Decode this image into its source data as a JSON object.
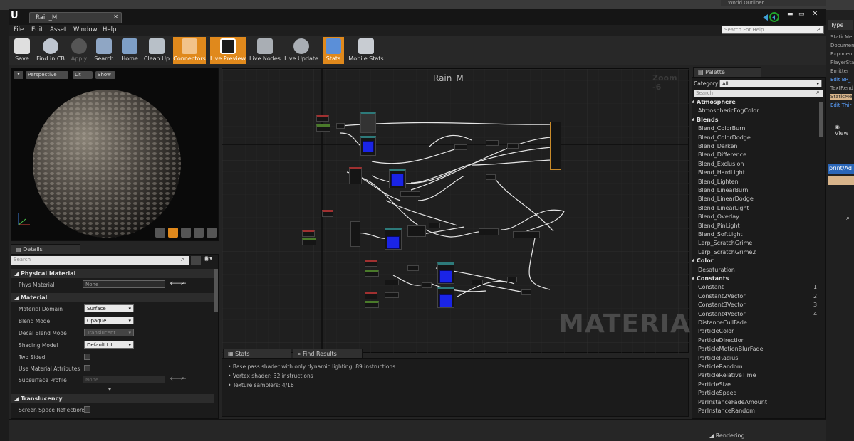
{
  "window": {
    "title": "Rain_M",
    "help_placeholder": "Search For Help"
  },
  "background": {
    "right_tab": "World Outliner"
  },
  "menu": [
    "File",
    "Edit",
    "Asset",
    "Window",
    "Help"
  ],
  "toolbar": [
    {
      "label": "Save",
      "active": false
    },
    {
      "label": "Find in CB",
      "active": false
    },
    {
      "label": "Apply",
      "active": false
    },
    {
      "label": "Search",
      "active": false
    },
    {
      "label": "Home",
      "active": false
    },
    {
      "label": "Clean Up",
      "active": false
    },
    {
      "label": "Connectors",
      "active": true
    },
    {
      "label": "Live Preview",
      "active": true
    },
    {
      "label": "Live Nodes",
      "active": false
    },
    {
      "label": "Live Update",
      "active": false
    },
    {
      "label": "Stats",
      "active": true
    },
    {
      "label": "Mobile Stats",
      "active": false
    }
  ],
  "viewport": {
    "perspective": "Perspective",
    "lit": "Lit",
    "show": "Show"
  },
  "details": {
    "tab": "Details",
    "search_placeholder": "Search",
    "physical_section": "Physical Material",
    "phys_material_label": "Phys Material",
    "phys_material_value": "None",
    "material_section": "Material",
    "rows": [
      {
        "label": "Material Domain",
        "value": "Surface"
      },
      {
        "label": "Blend Mode",
        "value": "Opaque"
      },
      {
        "label": "Decal Blend Mode",
        "value": "Translucent"
      },
      {
        "label": "Shading Model",
        "value": "Default Lit"
      }
    ],
    "two_sided": "Two Sided",
    "use_attrs": "Use Material Attributes",
    "subsurface_label": "Subsurface Profile",
    "subsurface_value": "None",
    "translucency_section": "Translucency",
    "ssr": "Screen Space Reflections"
  },
  "graph": {
    "title": "Rain_M",
    "zoom": "Zoom -6",
    "watermark": "MATERIAL"
  },
  "stats": {
    "tab": "Stats",
    "find_tab": "Find Results",
    "lines": [
      "Base pass shader with only dynamic lighting: 89 instructions",
      "Vertex shader: 32 instructions",
      "Texture samplers: 4/16"
    ]
  },
  "palette": {
    "tab": "Palette",
    "category_label": "Category:",
    "category_value": "All",
    "search_placeholder": "Search",
    "items": [
      {
        "text": "Atmosphere",
        "cat": true
      },
      {
        "text": "AtmosphericFogColor"
      },
      {
        "text": "Blends",
        "cat": true
      },
      {
        "text": "Blend_ColorBurn"
      },
      {
        "text": "Blend_ColorDodge"
      },
      {
        "text": "Blend_Darken"
      },
      {
        "text": "Blend_Difference"
      },
      {
        "text": "Blend_Exclusion"
      },
      {
        "text": "Blend_HardLight"
      },
      {
        "text": "Blend_Lighten"
      },
      {
        "text": "Blend_LinearBurn"
      },
      {
        "text": "Blend_LinearDodge"
      },
      {
        "text": "Blend_LinearLight"
      },
      {
        "text": "Blend_Overlay"
      },
      {
        "text": "Blend_PinLight"
      },
      {
        "text": "Blend_SoftLight"
      },
      {
        "text": "Lerp_ScratchGrime"
      },
      {
        "text": "Lerp_ScratchGrime2"
      },
      {
        "text": "Color",
        "cat": true
      },
      {
        "text": "Desaturation"
      },
      {
        "text": "Constants",
        "cat": true
      },
      {
        "text": "Constant",
        "num": "1"
      },
      {
        "text": "Constant2Vector",
        "num": "2"
      },
      {
        "text": "Constant3Vector",
        "num": "3"
      },
      {
        "text": "Constant4Vector",
        "num": "4"
      },
      {
        "text": "DistanceCullFade"
      },
      {
        "text": "ParticleColor"
      },
      {
        "text": "ParticleDirection"
      },
      {
        "text": "ParticleMotionBlurFade"
      },
      {
        "text": "ParticleRadius"
      },
      {
        "text": "ParticleRandom"
      },
      {
        "text": "ParticleRelativeTime"
      },
      {
        "text": "ParticleSize"
      },
      {
        "text": "ParticleSpeed"
      },
      {
        "text": "PerInstanceFadeAmount"
      },
      {
        "text": "PerInstanceRandom"
      }
    ]
  },
  "right_panel": {
    "type_header": "Type",
    "types": [
      "StaticMe",
      "Documen",
      "Exponen",
      "PlayerSta",
      "Emitter",
      "Edit BP_",
      "TextRend",
      "StaticMe",
      "Edit Thir"
    ],
    "view": "View",
    "blueprint": "print/Ad",
    "rendering": "Rendering"
  }
}
